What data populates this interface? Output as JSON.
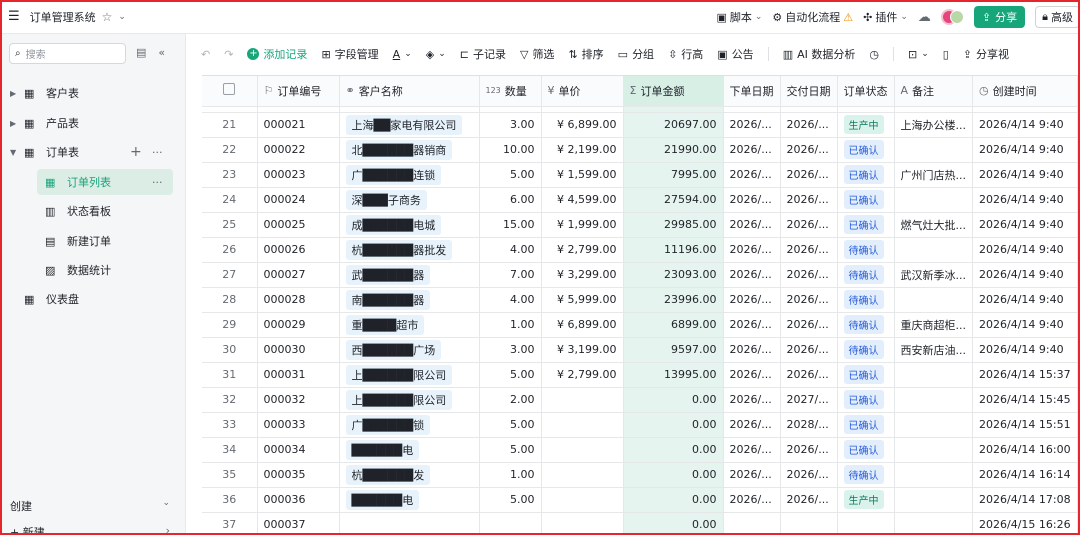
{
  "app": {
    "title": "订单管理系统"
  },
  "topbar": {
    "script_label": "脚本",
    "automation_label": "自动化流程",
    "plugin_label": "插件",
    "share_label": "分享",
    "account_label": "高级"
  },
  "sidebar": {
    "search_placeholder": "搜索",
    "items": [
      {
        "label": "客户表"
      },
      {
        "label": "产品表"
      },
      {
        "label": "订单表"
      },
      {
        "label": "订单列表"
      },
      {
        "label": "状态看板"
      },
      {
        "label": "新建订单"
      },
      {
        "label": "数据统计"
      },
      {
        "label": "仪表盘"
      }
    ],
    "create_label": "创建",
    "new_label": "新建"
  },
  "toolbar": {
    "add_record": "添加记录",
    "field_manage": "字段管理",
    "sub_record": "子记录",
    "filter": "筛选",
    "sort": "排序",
    "group": "分组",
    "row_height": "行高",
    "announce": "公告",
    "ai_analysis": "AI 数据分析",
    "share_view": "分享视"
  },
  "table": {
    "columns": [
      {
        "label": "订单编号",
        "icon": "flag-icon"
      },
      {
        "label": "客户名称",
        "icon": "link-icon"
      },
      {
        "label": "数量",
        "icon": "number-icon"
      },
      {
        "label": "单价",
        "icon": "yen-icon"
      },
      {
        "label": "订单金额",
        "icon": "sigma-icon"
      },
      {
        "label": "下单日期",
        "icon": ""
      },
      {
        "label": "交付日期",
        "icon": ""
      },
      {
        "label": "订单状态",
        "icon": ""
      },
      {
        "label": "备注",
        "icon": "text-icon"
      },
      {
        "label": "创建时间",
        "icon": "clock-icon"
      }
    ],
    "rows": [
      {
        "no": "21",
        "id": "000021",
        "customer": "上海██家电有限公司",
        "qty": "3.00",
        "price": "¥ 6,899.00",
        "amount": "20697.00",
        "order_date": "2026/...",
        "delivery": "2026/...",
        "status": "生产中",
        "note": "上海办公楼...",
        "created": "2026/4/14 9:40"
      },
      {
        "no": "22",
        "id": "000022",
        "customer": "北██████器销商",
        "qty": "10.00",
        "price": "¥ 2,199.00",
        "amount": "21990.00",
        "order_date": "2026/...",
        "delivery": "2026/...",
        "status": "已确认",
        "note": "",
        "created": "2026/4/14 9:40"
      },
      {
        "no": "23",
        "id": "000023",
        "customer": "广██████连锁",
        "qty": "5.00",
        "price": "¥ 1,599.00",
        "amount": "7995.00",
        "order_date": "2026/...",
        "delivery": "2026/...",
        "status": "已确认",
        "note": "广州门店热...",
        "created": "2026/4/14 9:40"
      },
      {
        "no": "24",
        "id": "000024",
        "customer": "深███子商务",
        "qty": "6.00",
        "price": "¥ 4,599.00",
        "amount": "27594.00",
        "order_date": "2026/...",
        "delivery": "2026/...",
        "status": "已确认",
        "note": "",
        "created": "2026/4/14 9:40"
      },
      {
        "no": "25",
        "id": "000025",
        "customer": "成██████电城",
        "qty": "15.00",
        "price": "¥ 1,999.00",
        "amount": "29985.00",
        "order_date": "2026/...",
        "delivery": "2026/...",
        "status": "已确认",
        "note": "燃气灶大批...",
        "created": "2026/4/14 9:40"
      },
      {
        "no": "26",
        "id": "000026",
        "customer": "杭██████器批发",
        "qty": "4.00",
        "price": "¥ 2,799.00",
        "amount": "11196.00",
        "order_date": "2026/...",
        "delivery": "2026/...",
        "status": "待确认",
        "note": "",
        "created": "2026/4/14 9:40"
      },
      {
        "no": "27",
        "id": "000027",
        "customer": "武██████器",
        "qty": "7.00",
        "price": "¥ 3,299.00",
        "amount": "23093.00",
        "order_date": "2026/...",
        "delivery": "2026/...",
        "status": "待确认",
        "note": "武汉新季冰...",
        "created": "2026/4/14 9:40"
      },
      {
        "no": "28",
        "id": "000028",
        "customer": "南██████器",
        "qty": "4.00",
        "price": "¥ 5,999.00",
        "amount": "23996.00",
        "order_date": "2026/...",
        "delivery": "2026/...",
        "status": "待确认",
        "note": "",
        "created": "2026/4/14 9:40"
      },
      {
        "no": "29",
        "id": "000029",
        "customer": "重████超市",
        "qty": "1.00",
        "price": "¥ 6,899.00",
        "amount": "6899.00",
        "order_date": "2026/...",
        "delivery": "2026/...",
        "status": "待确认",
        "note": "重庆商超柜...",
        "created": "2026/4/14 9:40"
      },
      {
        "no": "30",
        "id": "000030",
        "customer": "西██████广场",
        "qty": "3.00",
        "price": "¥ 3,199.00",
        "amount": "9597.00",
        "order_date": "2026/...",
        "delivery": "2026/...",
        "status": "待确认",
        "note": "西安新店油...",
        "created": "2026/4/14 9:40"
      },
      {
        "no": "31",
        "id": "000031",
        "customer": "上██████限公司",
        "qty": "5.00",
        "price": "¥ 2,799.00",
        "amount": "13995.00",
        "order_date": "2026/...",
        "delivery": "2026/...",
        "status": "已确认",
        "note": "",
        "created": "2026/4/14 15:37"
      },
      {
        "no": "32",
        "id": "000032",
        "customer": "上██████限公司",
        "qty": "2.00",
        "price": "",
        "amount": "0.00",
        "order_date": "2026/...",
        "delivery": "2027/...",
        "status": "已确认",
        "note": "",
        "created": "2026/4/14 15:45"
      },
      {
        "no": "33",
        "id": "000033",
        "customer": "广██████锁",
        "qty": "5.00",
        "price": "",
        "amount": "0.00",
        "order_date": "2026/...",
        "delivery": "2028/...",
        "status": "已确认",
        "note": "",
        "created": "2026/4/14 15:51"
      },
      {
        "no": "34",
        "id": "000034",
        "customer": "██████电",
        "qty": "5.00",
        "price": "",
        "amount": "0.00",
        "order_date": "2026/...",
        "delivery": "2026/...",
        "status": "已确认",
        "note": "",
        "created": "2026/4/14 16:00"
      },
      {
        "no": "35",
        "id": "000035",
        "customer": "杭██████发",
        "qty": "1.00",
        "price": "",
        "amount": "0.00",
        "order_date": "2026/...",
        "delivery": "2026/...",
        "status": "待确认",
        "note": "",
        "created": "2026/4/14 16:14"
      },
      {
        "no": "36",
        "id": "000036",
        "customer": "██████电",
        "qty": "5.00",
        "price": "",
        "amount": "0.00",
        "order_date": "2026/...",
        "delivery": "2026/...",
        "status": "生产中",
        "note": "",
        "created": "2026/4/14 17:08"
      },
      {
        "no": "37",
        "id": "000037",
        "customer": "",
        "qty": "",
        "price": "",
        "amount": "0.00",
        "order_date": "",
        "delivery": "",
        "status": "",
        "note": "",
        "created": "2026/4/15 16:26"
      }
    ]
  },
  "colors": {
    "accent": "#17a57a",
    "selected_bg": "#dbede5",
    "amount_col_bg": "#e6f4ef",
    "tag_blue_bg": "#e3eefc",
    "tag_blue_text": "#245bdb",
    "tag_green_bg": "#d9f3ec",
    "frame_red": "#e5262c"
  }
}
